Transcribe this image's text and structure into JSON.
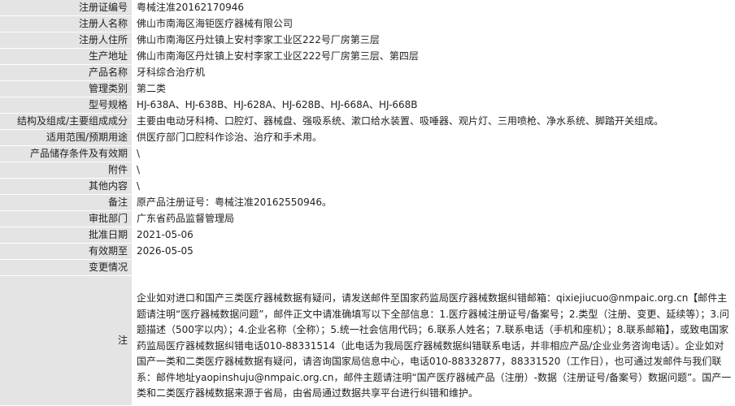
{
  "rows": [
    {
      "label": "注册证编号",
      "value": "粤械注准20162170946"
    },
    {
      "label": "注册人名称",
      "value": "佛山市南海区海钜医疗器械有限公司"
    },
    {
      "label": "注册人住所",
      "value": "佛山市南海区丹灶镇上安村李家工业区222号厂房第三层"
    },
    {
      "label": "生产地址",
      "value": "佛山市南海区丹灶镇上安村李家工业区222号厂房第三层、第四层"
    },
    {
      "label": "产品名称",
      "value": "牙科综合治疗机"
    },
    {
      "label": "管理类别",
      "value": "第二类"
    },
    {
      "label": "型号规格",
      "value": "HJ-638A、HJ-638B、HJ-628A、HJ-628B、HJ-668A、HJ-668B"
    },
    {
      "label": "结构及组成/主要组成成分",
      "value": "主要由电动牙科椅、口腔灯、器械盘、强吸系统、漱口给水装置、吸唾器、观片灯、三用喷枪、净水系统、脚踏开关组成。"
    },
    {
      "label": "适用范围/预期用途",
      "value": "供医疗部门口腔科作诊治、治疗和手术用。"
    },
    {
      "label": "产品储存条件及有效期",
      "value": "\\"
    },
    {
      "label": "附件",
      "value": "\\"
    },
    {
      "label": "其他内容",
      "value": "\\"
    },
    {
      "label": "备注",
      "value": "原产品注册证号：粤械注准20162550946。"
    },
    {
      "label": "审批部门",
      "value": "广东省药品监督管理局"
    },
    {
      "label": "批准日期",
      "value": "2021-05-06"
    },
    {
      "label": "有效期至",
      "value": "2026-05-05"
    },
    {
      "label": "变更情况",
      "value": ""
    }
  ],
  "note": {
    "label": "注",
    "text": "企业如对进口和国产三类医疗器械数据有疑问，请发送邮件至国家药监局医疗器械数据纠错邮箱：qixiejiucuo@nmpaic.org.cn【邮件主题请注明“医疗器械数据问题”，邮件正文中请准确填写以下全部信息：1.医疗器械注册证号/备案号；2.类型（注册、变更、延续等）；3.问题描述（500字以内）；4.企业名称（全称）；5.统一社会信用代码；6.联系人姓名；7.联系电话（手机和座机）；8.联系邮箱】，或致电国家药监局医疗器械数据纠错电话010-88331514（此电话为我局医疗器械数据纠错联系电话，并非相应产品/企业业务咨询电话）。企业如对国产一类和二类医疗器械数据有疑问，请咨询国家局信息中心，电话010-88332877，88331520（工作日），也可通过发邮件与我们联系：邮件地址yaopinshuju@nmpaic.org.cn，邮件主题请注明“国产医疗器械产品（注册）-数据（注册证号/备案号）数据问题”。国产一类和二类医疗器械数据来源于省局，由省局通过数据共享平台进行纠错和维护。"
  }
}
